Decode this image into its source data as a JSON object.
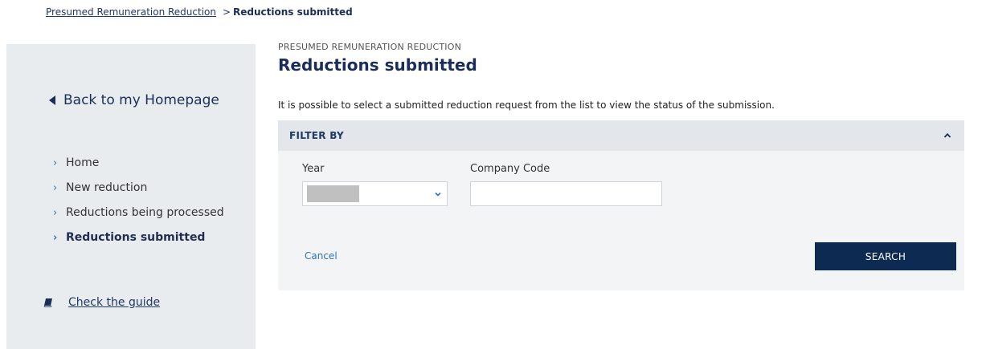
{
  "breadcrumb": {
    "parent": "Presumed Remuneration Reduction",
    "separator": ">",
    "current": "Reductions submitted"
  },
  "sidebar": {
    "back_label": "Back to my Homepage",
    "items": [
      {
        "label": "Home",
        "active": false
      },
      {
        "label": "New reduction",
        "active": false
      },
      {
        "label": "Reductions being processed",
        "active": false
      },
      {
        "label": "Reductions submitted",
        "active": true
      }
    ],
    "guide_label": "Check the guide"
  },
  "main": {
    "eyebrow": "PRESUMED REMUNERATION REDUCTION",
    "title": "Reductions submitted",
    "description": "It is possible to select a submitted reduction request from the list to view the status of the submission."
  },
  "filter": {
    "title": "FILTER BY",
    "year_label": "Year",
    "company_code_label": "Company Code",
    "company_code_value": "",
    "cancel_label": "Cancel",
    "search_label": "SEARCH"
  },
  "icons": {
    "back": "triangle-left-icon",
    "nav_chevron": "chevron-right-icon",
    "guide": "book-icon",
    "collapse": "chevron-up-icon",
    "dropdown": "chevron-down-icon"
  },
  "colors": {
    "primary_dark": "#0d2b52",
    "link": "#2e75b6",
    "sidebar_bg": "#e9ecef",
    "filter_header_bg": "#e3e6ea"
  }
}
